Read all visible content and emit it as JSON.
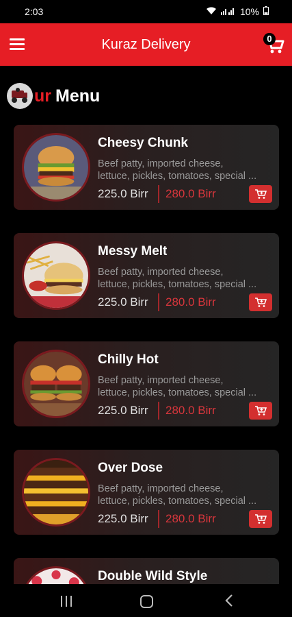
{
  "status": {
    "time": "2:03",
    "battery": "10%"
  },
  "app_bar": {
    "title": "Kuraz Delivery",
    "cart_count": "0"
  },
  "heading": {
    "part1": "ur",
    "part2": "Menu"
  },
  "items": [
    {
      "name": "Cheesy Chunk",
      "desc1": "Beef patty, imported cheese,",
      "desc2": "lettuce, pickles, tomatoes, special ...",
      "price": "225.0 Birr",
      "old_price": "280.0 Birr"
    },
    {
      "name": "Messy Melt",
      "desc1": "Beef patty, imported cheese,",
      "desc2": "lettuce, pickles, tomatoes, special ...",
      "price": "225.0 Birr",
      "old_price": "280.0 Birr"
    },
    {
      "name": "Chilly Hot",
      "desc1": "Beef patty, imported cheese,",
      "desc2": "lettuce, pickles, tomatoes, special ...",
      "price": "225.0 Birr",
      "old_price": "280.0 Birr"
    },
    {
      "name": "Over Dose",
      "desc1": "Beef patty, imported cheese,",
      "desc2": "lettuce, pickles, tomatoes, special ...",
      "price": "225.0 Birr",
      "old_price": "280.0 Birr"
    },
    {
      "name": "Double Wild Style",
      "desc1": "",
      "desc2": "",
      "price": "",
      "old_price": ""
    }
  ],
  "colors": {
    "accent": "#e61e25",
    "card_bg": "#252525",
    "old_price": "#d8363c"
  },
  "icons": [
    "menu-icon",
    "cart-icon",
    "add-to-cart-icon",
    "recents-icon",
    "home-icon",
    "back-icon"
  ]
}
